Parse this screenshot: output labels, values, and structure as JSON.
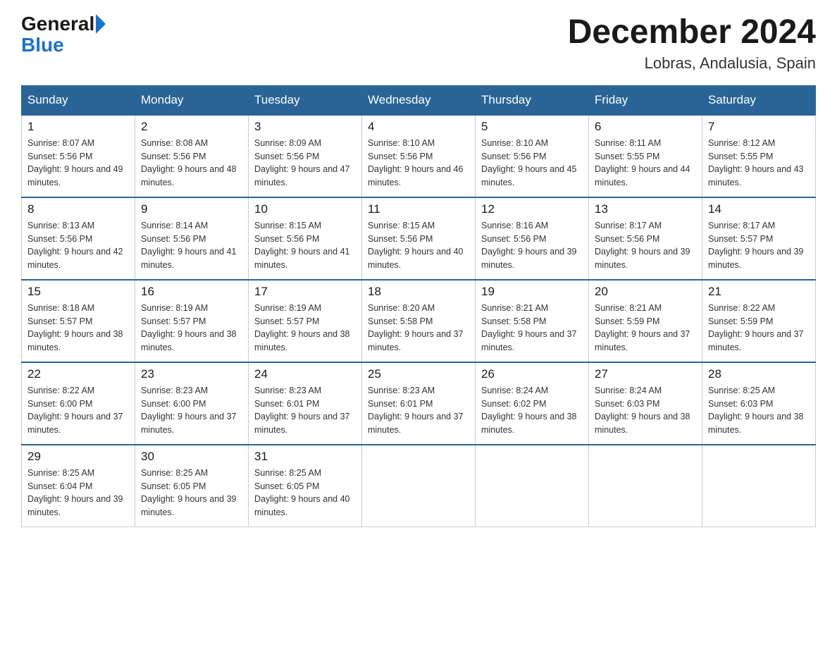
{
  "header": {
    "logo_general": "General",
    "logo_blue": "Blue",
    "month_title": "December 2024",
    "location": "Lobras, Andalusia, Spain"
  },
  "weekdays": [
    "Sunday",
    "Monday",
    "Tuesday",
    "Wednesday",
    "Thursday",
    "Friday",
    "Saturday"
  ],
  "weeks": [
    [
      {
        "day": "1",
        "sunrise": "8:07 AM",
        "sunset": "5:56 PM",
        "daylight": "9 hours and 49 minutes."
      },
      {
        "day": "2",
        "sunrise": "8:08 AM",
        "sunset": "5:56 PM",
        "daylight": "9 hours and 48 minutes."
      },
      {
        "day": "3",
        "sunrise": "8:09 AM",
        "sunset": "5:56 PM",
        "daylight": "9 hours and 47 minutes."
      },
      {
        "day": "4",
        "sunrise": "8:10 AM",
        "sunset": "5:56 PM",
        "daylight": "9 hours and 46 minutes."
      },
      {
        "day": "5",
        "sunrise": "8:10 AM",
        "sunset": "5:56 PM",
        "daylight": "9 hours and 45 minutes."
      },
      {
        "day": "6",
        "sunrise": "8:11 AM",
        "sunset": "5:55 PM",
        "daylight": "9 hours and 44 minutes."
      },
      {
        "day": "7",
        "sunrise": "8:12 AM",
        "sunset": "5:55 PM",
        "daylight": "9 hours and 43 minutes."
      }
    ],
    [
      {
        "day": "8",
        "sunrise": "8:13 AM",
        "sunset": "5:56 PM",
        "daylight": "9 hours and 42 minutes."
      },
      {
        "day": "9",
        "sunrise": "8:14 AM",
        "sunset": "5:56 PM",
        "daylight": "9 hours and 41 minutes."
      },
      {
        "day": "10",
        "sunrise": "8:15 AM",
        "sunset": "5:56 PM",
        "daylight": "9 hours and 41 minutes."
      },
      {
        "day": "11",
        "sunrise": "8:15 AM",
        "sunset": "5:56 PM",
        "daylight": "9 hours and 40 minutes."
      },
      {
        "day": "12",
        "sunrise": "8:16 AM",
        "sunset": "5:56 PM",
        "daylight": "9 hours and 39 minutes."
      },
      {
        "day": "13",
        "sunrise": "8:17 AM",
        "sunset": "5:56 PM",
        "daylight": "9 hours and 39 minutes."
      },
      {
        "day": "14",
        "sunrise": "8:17 AM",
        "sunset": "5:57 PM",
        "daylight": "9 hours and 39 minutes."
      }
    ],
    [
      {
        "day": "15",
        "sunrise": "8:18 AM",
        "sunset": "5:57 PM",
        "daylight": "9 hours and 38 minutes."
      },
      {
        "day": "16",
        "sunrise": "8:19 AM",
        "sunset": "5:57 PM",
        "daylight": "9 hours and 38 minutes."
      },
      {
        "day": "17",
        "sunrise": "8:19 AM",
        "sunset": "5:57 PM",
        "daylight": "9 hours and 38 minutes."
      },
      {
        "day": "18",
        "sunrise": "8:20 AM",
        "sunset": "5:58 PM",
        "daylight": "9 hours and 37 minutes."
      },
      {
        "day": "19",
        "sunrise": "8:21 AM",
        "sunset": "5:58 PM",
        "daylight": "9 hours and 37 minutes."
      },
      {
        "day": "20",
        "sunrise": "8:21 AM",
        "sunset": "5:59 PM",
        "daylight": "9 hours and 37 minutes."
      },
      {
        "day": "21",
        "sunrise": "8:22 AM",
        "sunset": "5:59 PM",
        "daylight": "9 hours and 37 minutes."
      }
    ],
    [
      {
        "day": "22",
        "sunrise": "8:22 AM",
        "sunset": "6:00 PM",
        "daylight": "9 hours and 37 minutes."
      },
      {
        "day": "23",
        "sunrise": "8:23 AM",
        "sunset": "6:00 PM",
        "daylight": "9 hours and 37 minutes."
      },
      {
        "day": "24",
        "sunrise": "8:23 AM",
        "sunset": "6:01 PM",
        "daylight": "9 hours and 37 minutes."
      },
      {
        "day": "25",
        "sunrise": "8:23 AM",
        "sunset": "6:01 PM",
        "daylight": "9 hours and 37 minutes."
      },
      {
        "day": "26",
        "sunrise": "8:24 AM",
        "sunset": "6:02 PM",
        "daylight": "9 hours and 38 minutes."
      },
      {
        "day": "27",
        "sunrise": "8:24 AM",
        "sunset": "6:03 PM",
        "daylight": "9 hours and 38 minutes."
      },
      {
        "day": "28",
        "sunrise": "8:25 AM",
        "sunset": "6:03 PM",
        "daylight": "9 hours and 38 minutes."
      }
    ],
    [
      {
        "day": "29",
        "sunrise": "8:25 AM",
        "sunset": "6:04 PM",
        "daylight": "9 hours and 39 minutes."
      },
      {
        "day": "30",
        "sunrise": "8:25 AM",
        "sunset": "6:05 PM",
        "daylight": "9 hours and 39 minutes."
      },
      {
        "day": "31",
        "sunrise": "8:25 AM",
        "sunset": "6:05 PM",
        "daylight": "9 hours and 40 minutes."
      },
      null,
      null,
      null,
      null
    ]
  ]
}
